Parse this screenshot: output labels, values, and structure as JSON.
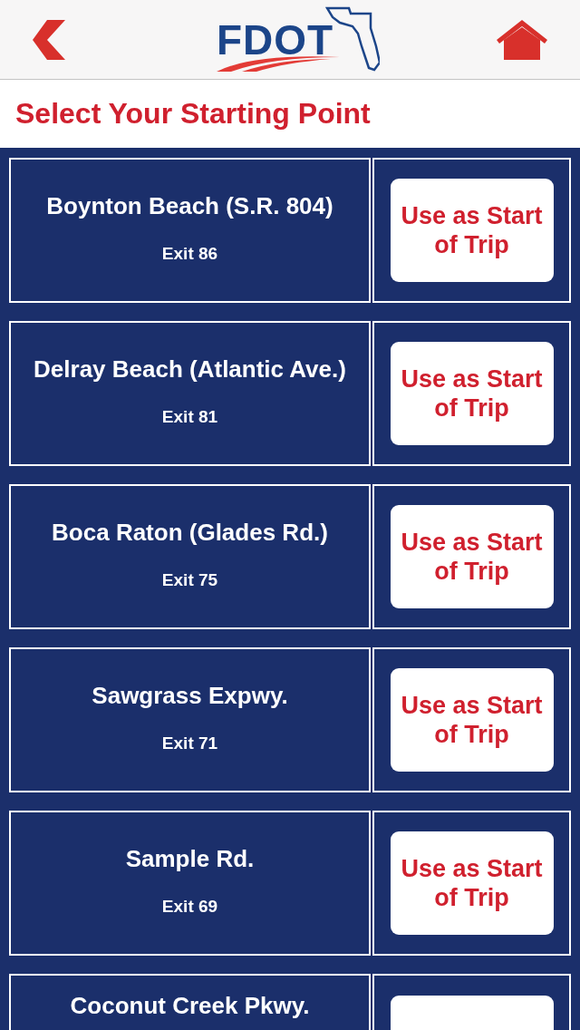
{
  "header": {
    "logo_text": "FDOT"
  },
  "title": "Select Your Starting Point",
  "rows": [
    {
      "name": "Boynton Beach (S.R. 804)",
      "exit": "Exit 86",
      "button_label": "Use as Start of Trip"
    },
    {
      "name": "Delray Beach (Atlantic Ave.)",
      "exit": "Exit 81",
      "button_label": "Use as Start of Trip"
    },
    {
      "name": "Boca Raton (Glades Rd.)",
      "exit": "Exit 75",
      "button_label": "Use as Start of Trip"
    },
    {
      "name": "Sawgrass Expwy.",
      "exit": "Exit 71",
      "button_label": "Use as Start of Trip"
    },
    {
      "name": "Sample Rd.",
      "exit": "Exit 69",
      "button_label": "Use as Start of Trip"
    },
    {
      "name": "Coconut Creek Pkwy."
    }
  ]
}
